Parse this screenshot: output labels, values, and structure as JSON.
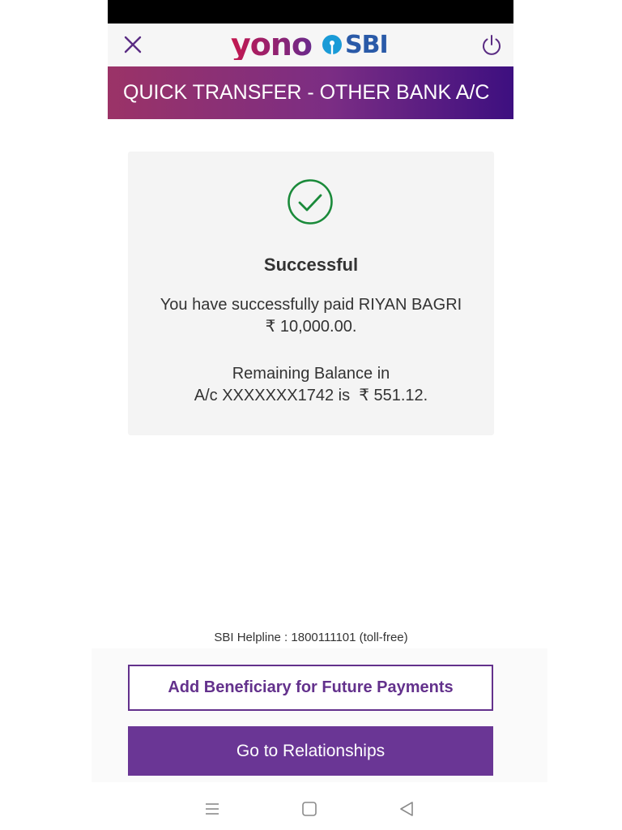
{
  "header": {
    "logo_yono": "yono",
    "logo_sbi": "SBI",
    "close_icon": "close-icon",
    "power_icon": "power-icon"
  },
  "banner": {
    "title": "QUICK TRANSFER - OTHER BANK A/C"
  },
  "result": {
    "icon": "check-circle-icon",
    "status": "Successful",
    "paid_line1": "You have successfully paid RIYAN BAGRI",
    "paid_line2": "₹ 10,000.00.",
    "balance_line1": "Remaining Balance in",
    "balance_line2": "A/c XXXXXXX1742 is  ₹ 551.12."
  },
  "footer": {
    "helpline": "SBI Helpline : 1800111101 (toll-free)",
    "add_beneficiary_label": "Add Beneficiary for Future Payments",
    "relationships_label": "Go to Relationships"
  },
  "nav": {
    "menu_icon": "menu-icon",
    "home_icon": "home-square-icon",
    "back_icon": "back-triangle-icon"
  },
  "colors": {
    "brand_purple": "#63318c",
    "button_purple": "#6a3695",
    "success_green": "#1a8a3a",
    "sbi_blue": "#2a5aa8",
    "yono_magenta": "#8a1f6e"
  }
}
